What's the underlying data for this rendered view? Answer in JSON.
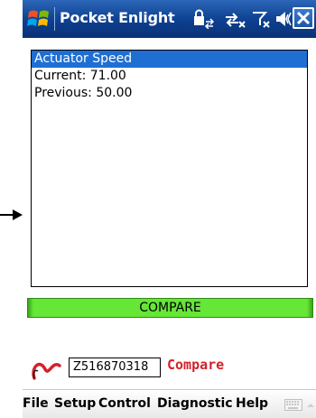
{
  "window": {
    "title": "Pocket Enlight",
    "start_icon": "windows-flag-icon",
    "tray_icons": [
      "lock-sync-icon",
      "connectivity-icon",
      "signal-off-icon",
      "volume-icon"
    ],
    "close_icon": "close-icon"
  },
  "list": {
    "items": [
      "Actuator Speed",
      "Current: 71.00",
      "Previous: 50.00"
    ],
    "selected_index": 0,
    "accent": "#1f6fd3"
  },
  "compare_button": {
    "label": "COMPARE",
    "color": "#66e637"
  },
  "status": {
    "logo": "enlight-logo-icon",
    "device_id": "Z516870318",
    "mode": "Compare",
    "mode_color": "#d4212a"
  },
  "menu": {
    "items": [
      "File",
      "Setup",
      "Control",
      "Diagnostic",
      "Help"
    ],
    "keyboard_icon": "keyboard-icon"
  }
}
